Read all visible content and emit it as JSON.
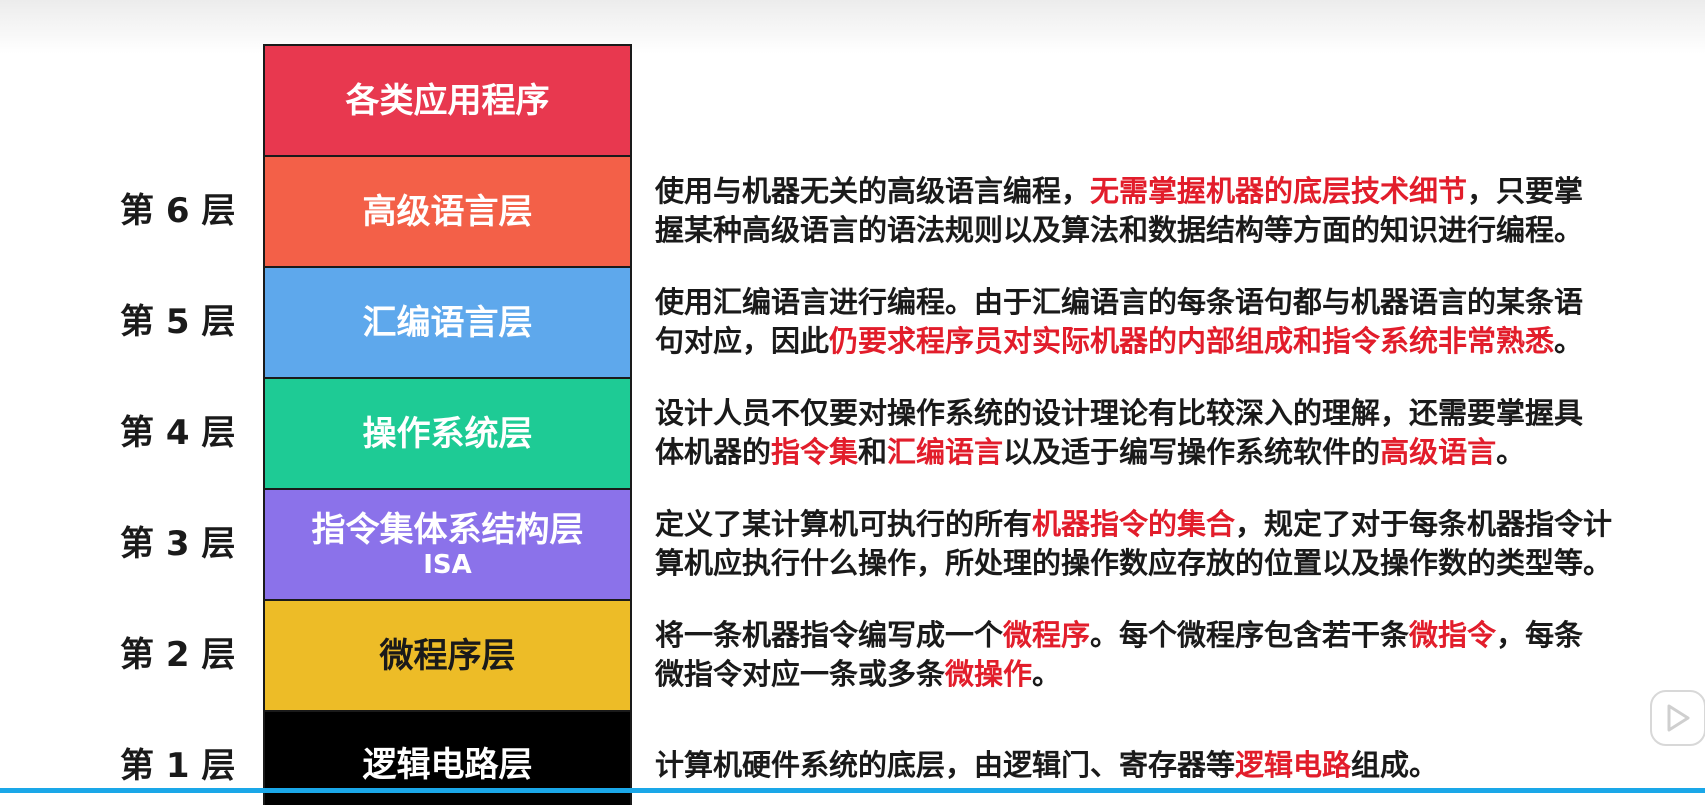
{
  "layers": [
    {
      "id": "app",
      "label": "",
      "name": "各类应用程序",
      "sub": "",
      "color": "#e8384f"
    },
    {
      "id": "l6",
      "label": "第 6 层",
      "name": "高级语言层",
      "sub": "",
      "color": "#f36048",
      "desc_lines": [
        [
          {
            "t": "使用与机器无关的高级语言编程，"
          },
          {
            "t": "无需掌握机器的底层技术细节",
            "hl": true
          },
          {
            "t": "，只要掌"
          }
        ],
        [
          {
            "t": "握某种高级语言的语法规则以及算法和数据结构等方面的知识进行编程。"
          }
        ]
      ]
    },
    {
      "id": "l5",
      "label": "第 5 层",
      "name": "汇编语言层",
      "sub": "",
      "color": "#5ea8ec",
      "desc_lines": [
        [
          {
            "t": "使用汇编语言进行编程。由于汇编语言的每条语句都与机器语言的某条语"
          }
        ],
        [
          {
            "t": "句对应，因此"
          },
          {
            "t": "仍要求程序员对实际机器的内部组成和指令系统非常熟悉",
            "hl": true
          },
          {
            "t": "。"
          }
        ]
      ]
    },
    {
      "id": "l4",
      "label": "第 4 层",
      "name": "操作系统层",
      "sub": "",
      "color": "#1ecb95",
      "desc_lines": [
        [
          {
            "t": "设计人员不仅要对操作系统的设计理论有比较深入的理解，还需要掌握具"
          }
        ],
        [
          {
            "t": "体机器的"
          },
          {
            "t": "指令集",
            "hl": true
          },
          {
            "t": "和"
          },
          {
            "t": "汇编语言",
            "hl": true
          },
          {
            "t": "以及适于编写操作系统软件的"
          },
          {
            "t": "高级语言",
            "hl": true
          },
          {
            "t": "。"
          }
        ]
      ]
    },
    {
      "id": "l3",
      "label": "第 3 层",
      "name": "指令集体系结构层",
      "sub": "ISA",
      "color": "#8b72ea",
      "desc_lines": [
        [
          {
            "t": "定义了某计算机可执行的所有"
          },
          {
            "t": "机器指令的集合",
            "hl": true
          },
          {
            "t": "，规定了对于每条机器指令计"
          }
        ],
        [
          {
            "t": "算机应执行什么操作，所处理的操作数应存放的位置以及操作数的类型等。"
          }
        ]
      ]
    },
    {
      "id": "l2",
      "label": "第 2 层",
      "name": "微程序层",
      "sub": "",
      "color": "#edbc27",
      "dark": true,
      "desc_lines": [
        [
          {
            "t": "将一条机器指令编写成一个"
          },
          {
            "t": "微程序",
            "hl": true
          },
          {
            "t": "。每个微程序包含若干条"
          },
          {
            "t": "微指令",
            "hl": true
          },
          {
            "t": "，每条"
          }
        ],
        [
          {
            "t": "微指令对应一条或多条"
          },
          {
            "t": "微操作",
            "hl": true
          },
          {
            "t": "。"
          }
        ]
      ]
    },
    {
      "id": "l1",
      "label": "第 1 层",
      "name": "逻辑电路层",
      "sub": "",
      "color": "#000000",
      "desc_lines": [
        [
          {
            "t": "计算机硬件系统的底层，由逻辑门、寄存器等"
          },
          {
            "t": "逻辑电路",
            "hl": true
          },
          {
            "t": "组成。"
          }
        ]
      ]
    }
  ],
  "player": {
    "progress_fraction": 1.0,
    "play_icon": "play-icon"
  }
}
